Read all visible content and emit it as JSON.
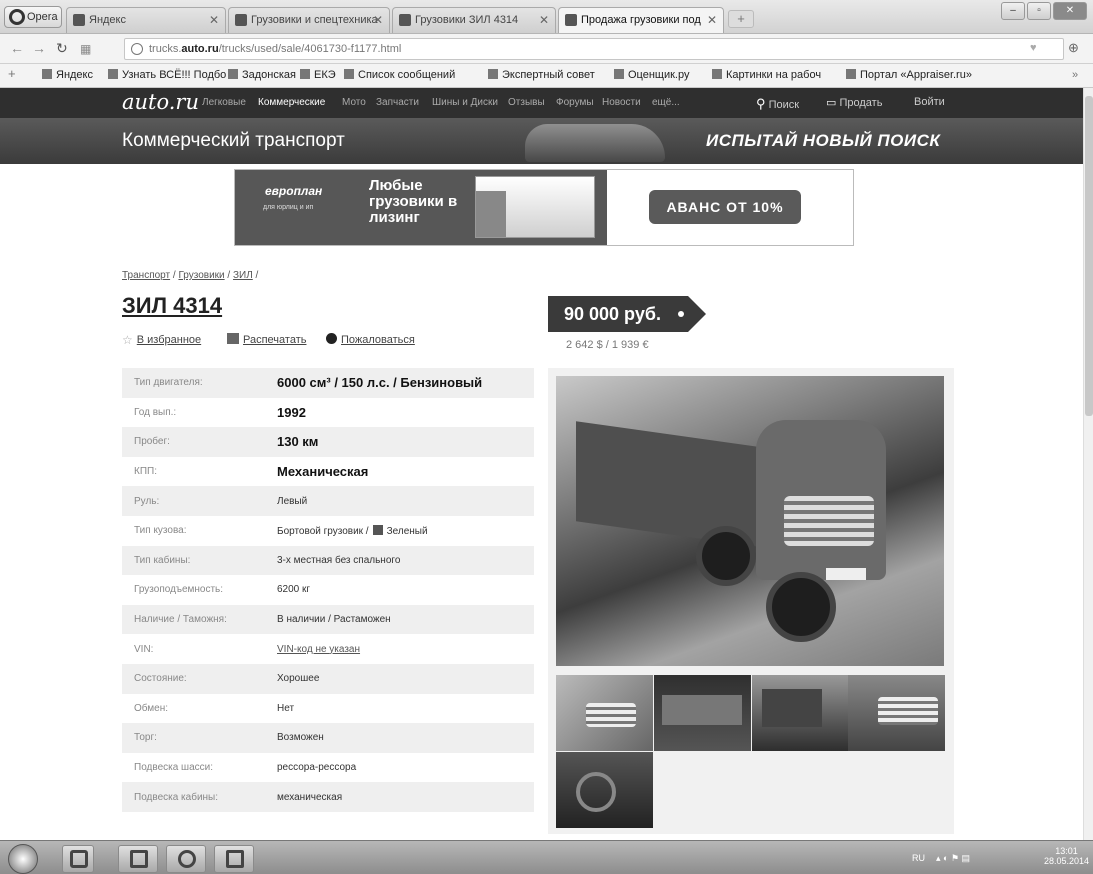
{
  "browser": {
    "opera_label": "Opera",
    "tabs": [
      {
        "label": "Яндекс"
      },
      {
        "label": "Грузовики и спецтехника"
      },
      {
        "label": "Грузовики ЗИЛ 4314"
      },
      {
        "label": "Продажа грузовики под"
      }
    ],
    "url_prefix": "trucks.",
    "url_host": "auto.ru",
    "url_path": "/trucks/used/sale/4061730-f1177.html",
    "bookmarks": [
      {
        "label": "Яндекс"
      },
      {
        "label": "Узнать ВСЁ!!! Подбо"
      },
      {
        "label": "Задонская"
      },
      {
        "label": "ЕКЭ"
      },
      {
        "label": "Список сообщений"
      },
      {
        "label": "Экспертный совет"
      },
      {
        "label": "Оценщик.ру"
      },
      {
        "label": "Картинки на рабоч"
      },
      {
        "label": "Портал «Appraiser.ru»"
      }
    ]
  },
  "site": {
    "logo": "auto.ru",
    "menu": [
      "Легковые",
      "Коммерческие",
      "Мото",
      "Запчасти",
      "Шины и Диски",
      "Отзывы",
      "Форумы",
      "Новости",
      "ещё..."
    ],
    "search_label": "Поиск",
    "sell_label": "Продать",
    "login_label": "Войти",
    "section_title": "Коммерческий транспорт",
    "new_search": "ИСПЫТАЙ НОВЫЙ ПОИСК"
  },
  "banner": {
    "brand": "европлан",
    "brand_sub": "для юрлиц и ип",
    "headline": "Любые грузовики в лизинг",
    "cta": "АВАНС ОТ 10%"
  },
  "listing": {
    "breadcrumb": [
      "Транспорт",
      "Грузовики",
      "ЗИЛ"
    ],
    "title": "ЗИЛ 4314",
    "actions": {
      "favorite": "В избранное",
      "print": "Распечатать",
      "report": "Пожаловаться"
    },
    "price": "90 000 руб.",
    "price_alt": "2 642 $ / 1 939 €",
    "specs": [
      {
        "key": "Тип двигателя:",
        "value": "6000 см³ / 150 л.с. / Бензиновый",
        "style": "big"
      },
      {
        "key": "Год вып.:",
        "value": "1992",
        "style": "big"
      },
      {
        "key": "Пробег:",
        "value": "130 км",
        "style": "big"
      },
      {
        "key": "КПП:",
        "value": "Механическая",
        "style": "big"
      },
      {
        "key": "Руль:",
        "value": "Левый",
        "style": "normal"
      },
      {
        "key": "Тип кузова:",
        "value": "Бортовой грузовик /",
        "value2": "Зеленый",
        "style": "color"
      },
      {
        "key": "Тип кабины:",
        "value": "3-х местная без спального",
        "style": "normal"
      },
      {
        "key": "Грузоподъемность:",
        "value": "6200 кг",
        "style": "normal"
      },
      {
        "key": "Наличие / Таможня:",
        "value": "В наличии / Растаможен",
        "style": "normal"
      },
      {
        "key": "VIN:",
        "value": "VIN-код не указан",
        "style": "link"
      },
      {
        "key": "Состояние:",
        "value": "Хорошее",
        "style": "normal"
      },
      {
        "key": "Обмен:",
        "value": "Нет",
        "style": "normal"
      },
      {
        "key": "Торг:",
        "value": "Возможен",
        "style": "normal"
      },
      {
        "key": "Подвеска шасси:",
        "value": "рессора-рессора",
        "style": "normal"
      },
      {
        "key": "Подвеска кабины:",
        "value": "механическая",
        "style": "normal"
      }
    ]
  },
  "taskbar": {
    "lang": "RU",
    "time": "13:01",
    "date": "28.05.2014"
  }
}
